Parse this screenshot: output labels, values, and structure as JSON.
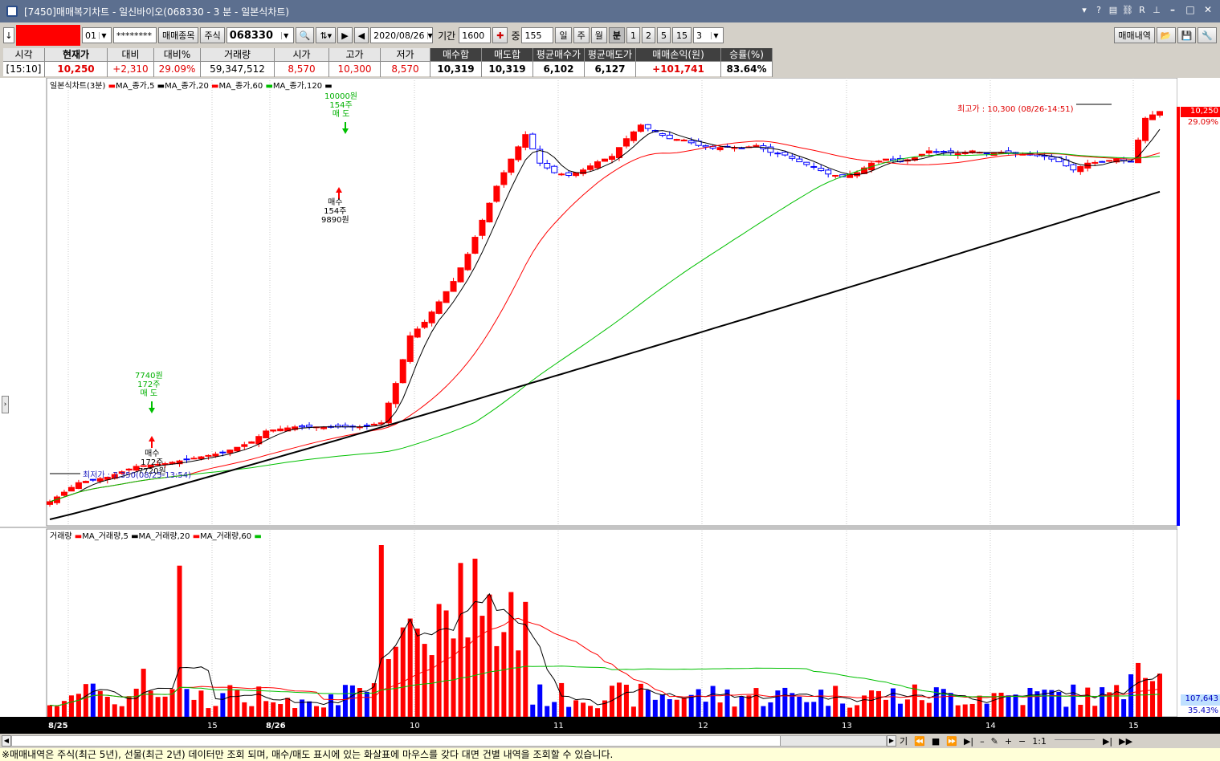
{
  "window": {
    "title": "[7450]매매복기차트 - 일신바이오(068330 - 3 분 - 일본식차트)",
    "toolbar_icons": [
      "?",
      "?",
      "?",
      "R",
      "?"
    ]
  },
  "toolbar": {
    "code_a": "01",
    "account_mask": "********",
    "trade_item_btn": "매매종목",
    "stock_type": "주식",
    "stock_code": "068330",
    "date": "2020/08/26",
    "period_label": "기간",
    "period_value": "1600",
    "count_label": "중",
    "count_value": "155",
    "units": [
      "일",
      "주",
      "월",
      "분",
      "1",
      "2",
      "5",
      "15"
    ],
    "unit_selected": "분",
    "interval": "3",
    "history_btn": "매매내역"
  },
  "info": {
    "columns": [
      {
        "header": "시각",
        "value": "[15:10]",
        "style": "plain",
        "width": 52
      },
      {
        "header": "현재가",
        "value": "10,250",
        "style": "red-bold-h",
        "width": 78
      },
      {
        "header": "대비",
        "value": "+2,310",
        "style": "red",
        "width": 58
      },
      {
        "header": "대비%",
        "value": "29.09%",
        "style": "red",
        "width": 58
      },
      {
        "header": "거래량",
        "value": "59,347,512",
        "style": "plain",
        "width": 92
      },
      {
        "header": "시가",
        "value": "8,570",
        "style": "red",
        "width": 68
      },
      {
        "header": "고가",
        "value": "10,300",
        "style": "red",
        "width": 64
      },
      {
        "header": "저가",
        "value": "8,570",
        "style": "red",
        "width": 62
      },
      {
        "header": "매수합",
        "value": "10,319",
        "style": "dark-bold",
        "width": 64
      },
      {
        "header": "매도합",
        "value": "10,319",
        "style": "dark-bold",
        "width": 64
      },
      {
        "header": "평균매수가",
        "value": "6,102",
        "style": "dark-bold",
        "width": 64
      },
      {
        "header": "평균매도가",
        "value": "6,127",
        "style": "dark-bold",
        "width": 64
      },
      {
        "header": "매매손익(원)",
        "value": "+101,741",
        "style": "dark-bold-red",
        "width": 106
      },
      {
        "header": "승률(%)",
        "value": "83.64%",
        "style": "dark-bold",
        "width": 64
      }
    ]
  },
  "chart_data": {
    "type": "candlestick",
    "title": "일본식차트(3분)",
    "legend": [
      "MA_종가,5",
      "MA_종가,20",
      "MA_종가,60",
      "MA_종가,120"
    ],
    "legend_colors": [
      "#ff0000",
      "#000000",
      "#ff0000",
      "#00c000",
      "#000000"
    ],
    "ylim": [
      7250,
      10450
    ],
    "annotations": {
      "high_label": "최고가 : 10,300 (08/26-14:51)",
      "low_label": "최저가 : 7,350(08/25-13:54)",
      "current_price": "10,250",
      "current_pct": "29.09%",
      "buy1": {
        "lines": [
          "매수",
          "172주",
          "7720원"
        ],
        "price": 7720
      },
      "sell1": {
        "lines": [
          "7740원",
          "172주",
          "매 도"
        ],
        "price": 7740
      },
      "buy2": {
        "lines": [
          "매수",
          "154주",
          "9890원"
        ],
        "price": 9890
      },
      "sell2": {
        "lines": [
          "10000원",
          "154주",
          "매 도"
        ],
        "price": 10000
      }
    },
    "x_labels": [
      "8/25",
      "15",
      "8/26",
      "10",
      "11",
      "12",
      "13",
      "14",
      "15"
    ],
    "volume": {
      "legend": [
        "거래량",
        "MA_거래량,5",
        "MA_거래량,20",
        "MA_거래량,60"
      ],
      "last_value": "107,643",
      "last_pct": "35.43%"
    }
  },
  "status": {
    "text": "※매매내역은 주식(최근 5년), 선물(최근 2년) 데이터만 조회 되며, 매수/매도 표시에 있는 화살표에 마우스를 갖다 대면 건별 내역을 조회할 수 있습니다."
  },
  "scroll": {
    "label_ga": "기",
    "ratio": "1:1"
  },
  "colors": {
    "up": "#ff0000",
    "down": "#0000ff",
    "ma5": "#000000",
    "ma20": "#ff0000",
    "ma60": "#00c000",
    "ma120": "#000000"
  }
}
